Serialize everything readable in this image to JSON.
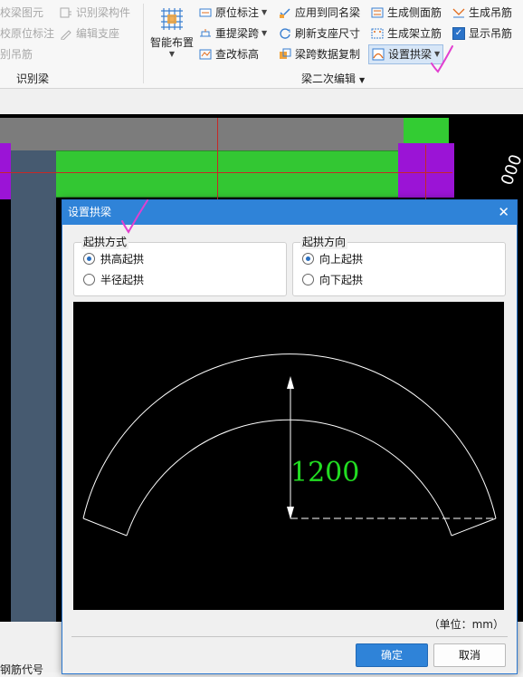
{
  "ribbon": {
    "left_items": [
      "校梁图元",
      "校原位标注",
      "别吊筋"
    ],
    "left_items2": [
      "识别梁构件",
      "编辑支座"
    ],
    "group1_label": "识别梁",
    "smart_layout": "智能布置",
    "col1": [
      "原位标注",
      "重提梁跨",
      "查改标高"
    ],
    "col2": [
      "应用到同名梁",
      "刷新支座尺寸",
      "梁跨数据复制"
    ],
    "col3": [
      "生成侧面筋",
      "生成架立筋",
      "设置拱梁"
    ],
    "col4": [
      "生成吊筋",
      "显示吊筋"
    ],
    "group2_label": "梁二次编辑"
  },
  "canvas": {
    "partial_text": "000",
    "bottom_text": "钢筋代号"
  },
  "dialog": {
    "title": "设置拱梁",
    "group_mode": {
      "legend": "起拱方式",
      "options": [
        "拱高起拱",
        "半径起拱"
      ],
      "selected": "拱高起拱"
    },
    "group_dir": {
      "legend": "起拱方向",
      "options": [
        "向上起拱",
        "向下起拱"
      ],
      "selected": "向上起拱"
    },
    "preview_value": "1200",
    "unit": "（单位：mm）",
    "ok": "确定",
    "cancel": "取消"
  },
  "colors": {
    "accent": "#2f83d8",
    "beam_green": "#33c733",
    "column_purple": "#9b14d6",
    "annotation_green": "#22dd22",
    "check_mark": "#e23fd0"
  }
}
